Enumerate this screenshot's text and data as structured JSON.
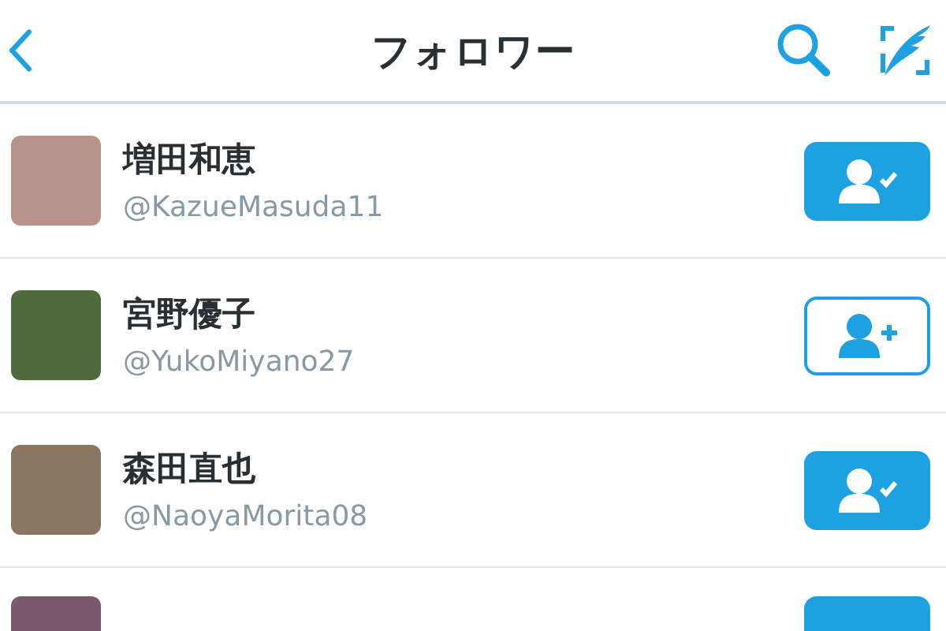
{
  "header": {
    "title": "フォロワー"
  },
  "users": [
    {
      "name": "増田和恵",
      "handle": "@KazueMasuda11",
      "following": true
    },
    {
      "name": "宮野優子",
      "handle": "@YukoMiyano27",
      "following": false
    },
    {
      "name": "森田直也",
      "handle": "@NaoyaMorita08",
      "following": true
    },
    {
      "following": true
    }
  ]
}
